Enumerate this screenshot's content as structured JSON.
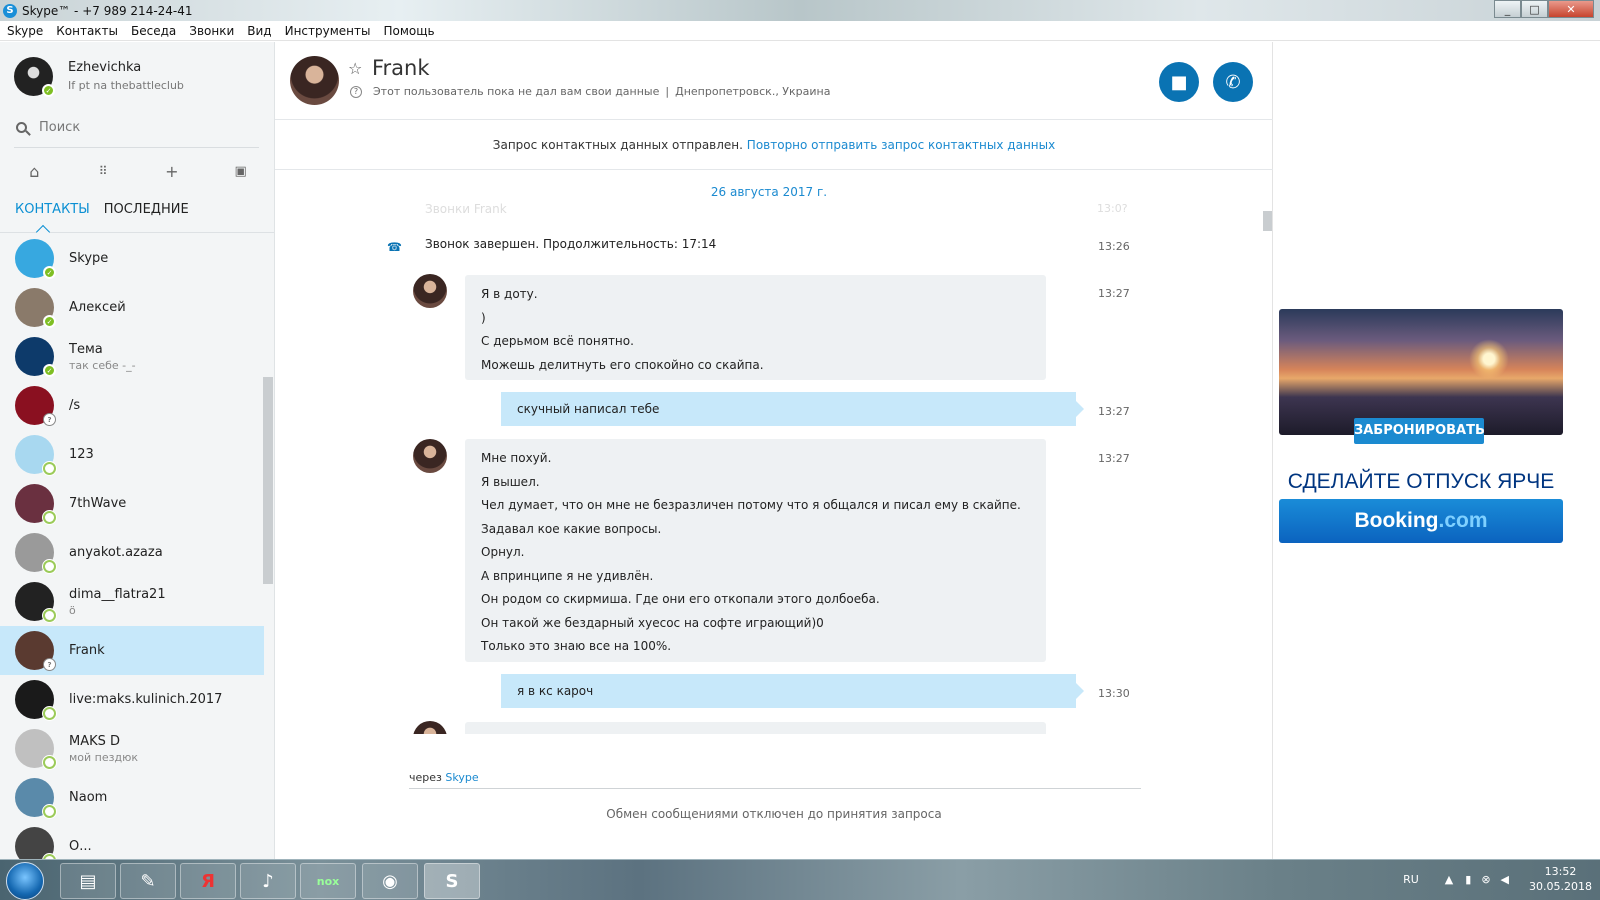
{
  "window": {
    "title": "Skype™ - +7 989 214-24-41",
    "min": "_",
    "max": "□",
    "close": "✕"
  },
  "menu": [
    "Skype",
    "Контакты",
    "Беседа",
    "Звонки",
    "Вид",
    "Инструменты",
    "Помощь"
  ],
  "profile": {
    "name": "Ezhevichka",
    "mood": "If pt na thebattleclub"
  },
  "search": {
    "placeholder": "Поиск"
  },
  "tabs": {
    "contacts": "КОНТАКТЫ",
    "recent": "ПОСЛЕДНИЕ"
  },
  "contacts": [
    {
      "name": "Skype",
      "mood": "",
      "status": "online",
      "color": "#37a8e0"
    },
    {
      "name": "Алексей",
      "mood": "",
      "status": "online",
      "color": "#8a7a6a"
    },
    {
      "name": "Тема",
      "mood": "так себе -_-",
      "status": "online",
      "color": "#0d3a6a"
    },
    {
      "name": "/s",
      "mood": "",
      "status": "unknown",
      "color": "#8a1020"
    },
    {
      "name": "123",
      "mood": "",
      "status": "offline",
      "color": "#a8d8f0"
    },
    {
      "name": "7thWave",
      "mood": "",
      "status": "offline",
      "color": "#6a3040"
    },
    {
      "name": "anyakot.azaza",
      "mood": "",
      "status": "offline",
      "color": "#9a9a9a"
    },
    {
      "name": "dima__flatra21",
      "mood": "ö",
      "status": "offline",
      "color": "#222222"
    },
    {
      "name": "Frank",
      "mood": "",
      "status": "unknown",
      "color": "#5a3a30"
    },
    {
      "name": "live:maks.kulinich.2017",
      "mood": "",
      "status": "offline",
      "color": "#1a1a1a"
    },
    {
      "name": "MAKS D",
      "mood": "мой пездюк",
      "status": "offline",
      "color": "#c0c0c0"
    },
    {
      "name": "Naom",
      "mood": "",
      "status": "offline",
      "color": "#5a8aaa"
    },
    {
      "name": "О...",
      "mood": "",
      "status": "offline",
      "color": "#444444"
    }
  ],
  "chat": {
    "name": "Frank",
    "subtitle": "Этот пользователь пока не дал вам свои данные",
    "location": "Днепропетровск., Украина",
    "request_text": "Запрос контактных данных отправлен.",
    "request_link": "Повторно отправить запрос контактных данных",
    "date": "26 августа 2017 г.",
    "faded_line": "Звонки Frank",
    "faded_time": "13:0?",
    "call_end": "Звонок завершен. Продолжительность: 17:14",
    "call_end_time": "13:26",
    "msg1": [
      "Я в доту.",
      ")",
      "С дерьмом всё понятно.",
      "Можешь делитнуть его спокойно со скайпа."
    ],
    "msg1_time": "13:27",
    "out1": "скучный написал тебе",
    "out1_time": "13:27",
    "msg2": [
      "Мне похуй.",
      "Я вышел.",
      "Чел думает, что он мне не безразличен потому что я общался и писал ему в скайпе.",
      "Задавал кое какие вопросы.",
      "Орнул.",
      "А впринципе я не удивлён.",
      "Он родом со скирмиша. Где они его откопали этого долбоеба.",
      "Он такой же бездарный хуесос на софте играющий)0",
      "Только это  знаю все на 100%."
    ],
    "msg2_time": "13:27",
    "out2": "я в кс кароч",
    "out2_time": "13:30",
    "via_prefix": "через",
    "via_link": "Skype",
    "disabled_text": "Обмен сообщениями отключен до принятия запроса"
  },
  "ads": {
    "button": "ЗАБРОНИРОВАТЬ",
    "headline": "СДЕЛАЙТЕ ОТПУСК ЯРЧЕ",
    "brand_a": "Booking",
    "brand_b": ".com"
  },
  "taskbar": {
    "lang": "RU",
    "time": "13:52",
    "date": "30.05.2018"
  }
}
